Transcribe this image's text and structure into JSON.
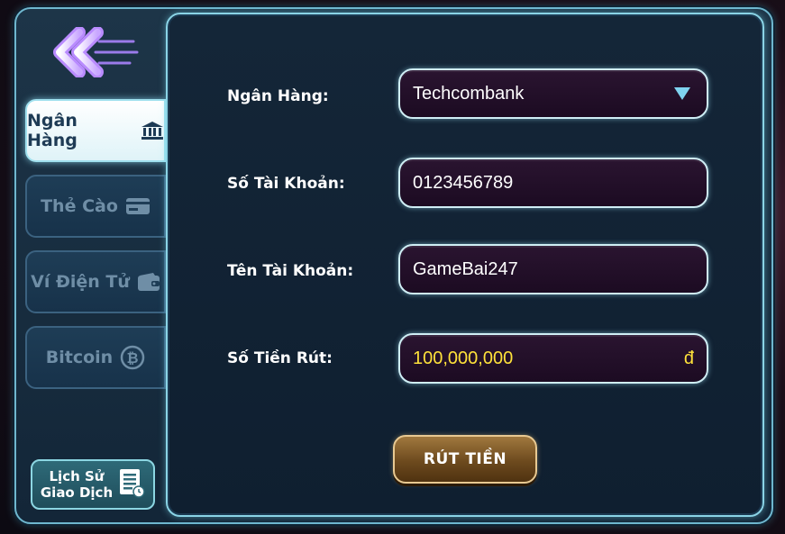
{
  "sidebar": {
    "back_icon": "double-chevron-left-icon",
    "tabs": [
      {
        "label": "Ngân Hàng",
        "icon": "bank-icon",
        "active": true
      },
      {
        "label": "Thẻ Cào",
        "icon": "card-icon",
        "active": false
      },
      {
        "label": "Ví Điện Tử",
        "icon": "wallet-icon",
        "active": false
      },
      {
        "label": "Bitcoin",
        "icon": "bitcoin-icon",
        "active": false
      }
    ],
    "history": {
      "line1": "Lịch Sử",
      "line2": "Giao Dịch",
      "icon": "history-icon"
    }
  },
  "form": {
    "bank": {
      "label": "Ngân Hàng:",
      "value": "Techcombank"
    },
    "account_number": {
      "label": "Số Tài Khoản:",
      "value": "0123456789"
    },
    "account_name": {
      "label": "Tên Tài Khoản:",
      "value": "GameBai247"
    },
    "amount": {
      "label": "Số Tiền Rút:",
      "value": "100,000,000",
      "currency": "đ"
    },
    "submit_label": "RÚT TIỀN"
  },
  "colors": {
    "accent": "#8ad4e6",
    "money": "#ffe23a",
    "button": "#6d4a1e"
  }
}
